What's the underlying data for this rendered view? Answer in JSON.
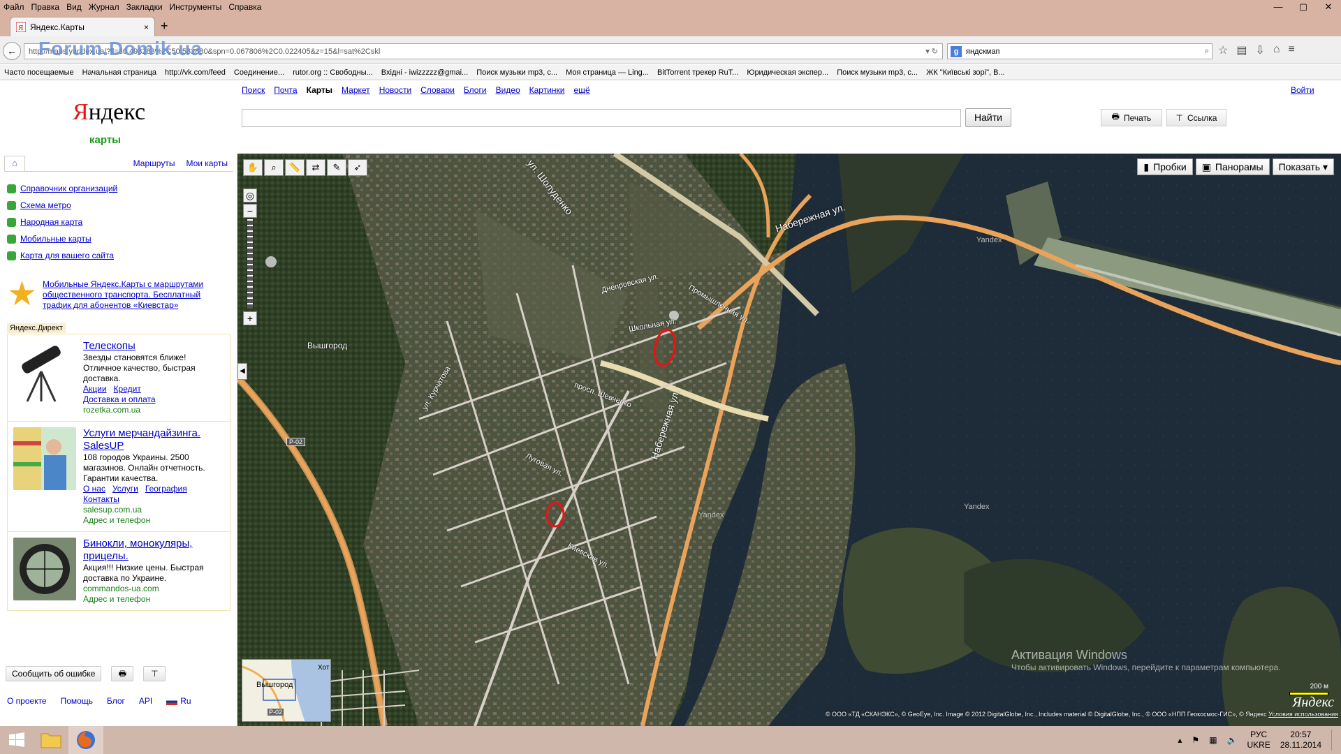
{
  "browser": {
    "menu": [
      "Файл",
      "Правка",
      "Вид",
      "Журнал",
      "Закладки",
      "Инструменты",
      "Справка"
    ],
    "window_controls": [
      "—",
      "▢",
      "✕"
    ],
    "tab_title": "Яндекс.Карты",
    "tab_close": "×",
    "new_tab": "+",
    "url": "http://maps.yandex.ua/?ll=30.493283%2C50.582880&spn=0.067806%2C0.022405&z=15&l=sat%2Cskl",
    "url_watermark": "Forum.Domik.ua",
    "search_engine": "g",
    "search_query": "яндскмап",
    "bookmarks": [
      "Часто посещаемые",
      "Начальная страница",
      "http://vk.com/feed",
      "Соединение...",
      "rutor.org :: Свободны...",
      "Вхідні - iwizzzzz@gmai...",
      "Поиск музыки mp3, с...",
      "Моя страница — Ling...",
      "BitTorrent трекер RuT...",
      "Юридическая экспер...",
      "Поиск музыки mp3, с...",
      "ЖК \"Київські зорі\", В..."
    ]
  },
  "header": {
    "logo_first": "Я",
    "logo_rest": "ндекс",
    "subtitle": "карты",
    "nav": [
      "Поиск",
      "Почта",
      "Карты",
      "Маркет",
      "Новости",
      "Словари",
      "Блоги",
      "Видео",
      "Картинки",
      "ещё"
    ],
    "current_nav": "Карты",
    "login": "Войти",
    "search_value": "",
    "find_button": "Найти",
    "print_button": "Печать",
    "link_button": "Ссылка"
  },
  "sidebar": {
    "tabs": [
      "Маршруты",
      "Мои карты"
    ],
    "links": [
      "Справочник организаций",
      "Схема метро",
      "Народная карта",
      "Мобильные карты",
      "Карта для вашего сайта"
    ],
    "promo": "Мобильные Яндекс.Карты с маршрутами общественного транспорта. Бесплатный трафик для абонентов «Киевстар»",
    "direct_label": "Яндекс.Директ",
    "ads": [
      {
        "title": "Телескопы",
        "text": "Звезды становятся ближе! Отличное качество, быстрая доставка.",
        "links": [
          "Акции",
          "Кредит",
          "Доставка и оплата"
        ],
        "domain": "rozetka.com.ua",
        "extra": ""
      },
      {
        "title": "Услуги мерчандайзинга. SalesUP",
        "text": "108 городов Украины. 2500 магазинов. Онлайн отчетность. Гарантии качества.",
        "links": [
          "О нас",
          "Услуги",
          "География",
          "Контакты"
        ],
        "domain": "salesup.com.ua",
        "extra": "Адрес и телефон"
      },
      {
        "title": "Бинокли, монокуляры, прицелы.",
        "text": "Акция!!! Низкие цены. Быстрая доставка по Украине.",
        "links": [],
        "domain": "commandos-ua.com",
        "extra": "Адрес и телефон"
      }
    ],
    "report_error": "Сообщить об ошибке",
    "footer": [
      "О проекте",
      "Помощь",
      "Блог",
      "API",
      "Ru"
    ]
  },
  "map": {
    "buttons": [
      "Пробки",
      "Панорамы",
      "Показать ▾"
    ],
    "labels": {
      "city": "Вышгород",
      "shopulenko": "ул. Шолуденко",
      "naberezhnaya_top": "Набережная ул.",
      "naberezhnaya_side": "Набережная ул.",
      "shevchenko": "просп. Шевченко",
      "shkolnaya": "Школьная ул.",
      "dneprovskaya": "Днепровская ул.",
      "promyshlennaya": "Промышленная ул.",
      "kievskaya": "Киевская ул.",
      "lugovaya": "Луговая ул.",
      "kurchatova": "ул. Курчатова",
      "r02": "Р-02",
      "yandex1": "Yandex",
      "yandex2": "Yandex",
      "yandex3": "Yandex"
    },
    "minimap_city": "Вышгород",
    "minimap_road": "Р-02",
    "minimap_hot": "Хот",
    "scale": "200 м",
    "logo": "Яндекс",
    "copyright": "© ООО «ТД «СКАНЭКС», © GeoEye, Inc. Image © 2012 DigitalGlobe, Inc., Includes material © DigitalGlobe, Inc., © ООО «НПП Геокосмос-ГИС», © Яндекс",
    "terms": "Условия использования",
    "win_activation_title": "Активация Windows",
    "win_activation_text": "Чтобы активировать Windows, перейдите к параметрам компьютера."
  },
  "taskbar": {
    "lang1": "РУС",
    "lang2": "UKRE",
    "time": "20:57",
    "date": "28.11.2014"
  },
  "colors": {
    "accent_link": "#0000cc",
    "logo_red": "#ee1111",
    "subtitle_green": "#1a9b1a",
    "road_orange": "#e9a35a",
    "river": "#1d2a36",
    "marker_red": "#ee1111"
  }
}
